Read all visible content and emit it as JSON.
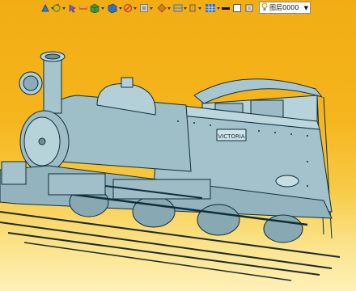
{
  "toolbar": {
    "items": [
      {
        "name": "sketch-plane-icon",
        "color": "#2f7bd6"
      },
      {
        "name": "cursor-spin-icon",
        "color": "#6c8e2a"
      },
      {
        "name": "pointer-icon",
        "color": "#7b5cc7"
      },
      {
        "name": "measure-icon",
        "color": "#d36a2a"
      },
      {
        "name": "render-cube-icon",
        "color": "#3a9c3a"
      },
      {
        "name": "view-orientation-icon",
        "color": "#2b72c8"
      },
      {
        "name": "hide-show-icon",
        "color": "#c23a3a"
      },
      {
        "name": "display-mode-icon",
        "color": "#777777"
      },
      {
        "name": "section-icon",
        "color": "#d07a22"
      },
      {
        "name": "appearance-icon",
        "color": "#4a7fc0"
      },
      {
        "name": "grid-icon",
        "color": "#3b6dbd"
      }
    ],
    "line_color": "#111111",
    "fill_color": "#ffffff",
    "layer": {
      "value": "图层0000",
      "dropdown_icon": "chevron-down-icon"
    }
  },
  "viewport": {
    "background_top": "#f2ad14",
    "background_bottom": "#fff0b8",
    "model_fill": "#a8c6cf",
    "model_edge": "#0e2e38",
    "plate_text": "VICTORIA"
  }
}
